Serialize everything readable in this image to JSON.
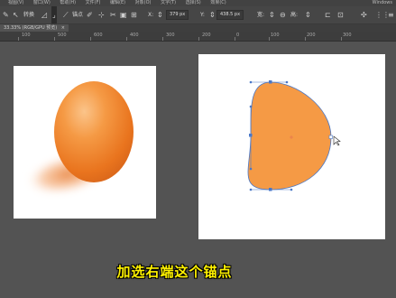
{
  "menubar": {
    "items": [
      "视图(V)",
      "窗口(W)",
      "帮助(H)",
      "文件(F)",
      "编辑(E)",
      "对象(O)",
      "文字(T)",
      "选择(S)",
      "效果(C)"
    ],
    "right_text": "Windows"
  },
  "options": {
    "transform_label": "转换",
    "anchor_label": "锚点",
    "x_label": "X:",
    "x_value": "379 px",
    "y_label": "Y:",
    "y_value": "438.5 px",
    "w_label": "宽:",
    "h_label": "高:"
  },
  "document": {
    "tab_label": "33.33% (RGB/GPU 预览)"
  },
  "ruler": {
    "ticks": [
      "100",
      "500",
      "600",
      "400",
      "300",
      "200",
      "0",
      "100",
      "200",
      "300"
    ]
  },
  "subtitle": "加选右端这个锚点",
  "colors": {
    "canvas_bg": "#535353",
    "egg_fill": "#f59a45",
    "path_stroke": "#4a78c8",
    "subtitle_color": "#fff200"
  }
}
